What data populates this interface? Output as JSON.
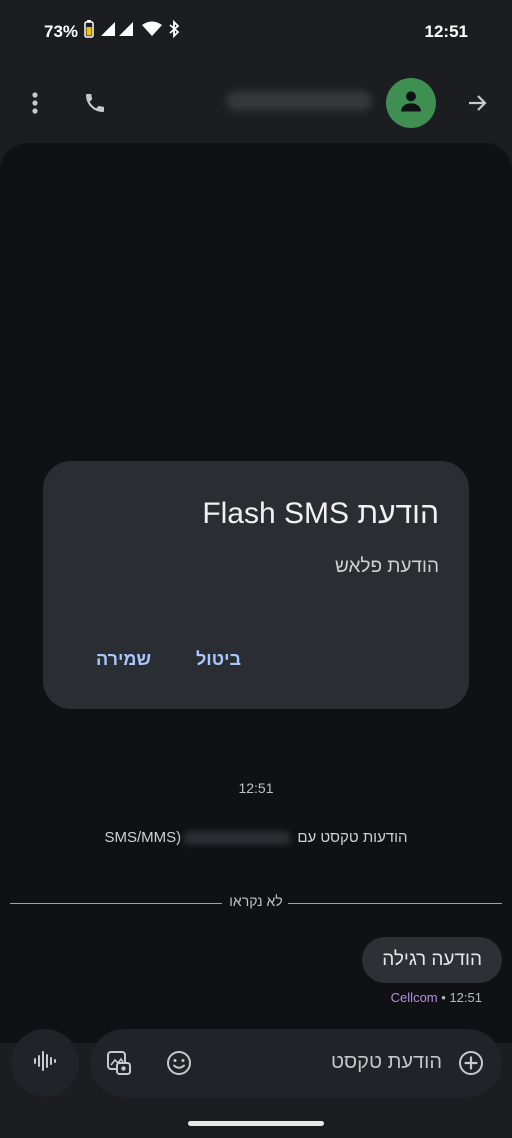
{
  "status_bar": {
    "battery": "73%",
    "time": "12:51"
  },
  "top_bar": {
    "contact_name": ""
  },
  "dialog": {
    "title": "הודעת Flash SMS",
    "message": "הודעת פלאש",
    "save_label": "שמירה",
    "cancel_label": "ביטול"
  },
  "conversation": {
    "timestamp": "12:51",
    "info_prefix": "הודעות טקסט עם",
    "info_suffix": "(SMS/MMS",
    "unread_label": "לא נקראו",
    "message_text": "הודעה רגילה",
    "message_time": "12:51",
    "message_sep": "•",
    "carrier": "Cellcom"
  },
  "compose": {
    "placeholder": "הודעת טקסט"
  },
  "colors": {
    "accent": "#a9c7ff",
    "avatar": "#3f8f53",
    "carrier": "#b78fe0"
  },
  "icons": [
    "battery-icon",
    "signal-icon",
    "wifi-icon",
    "bluetooth-icon",
    "more-vert-icon",
    "phone-icon",
    "person-icon",
    "arrow-forward-icon",
    "voice-icon",
    "gallery-icon",
    "emoji-icon",
    "add-circle-icon"
  ]
}
